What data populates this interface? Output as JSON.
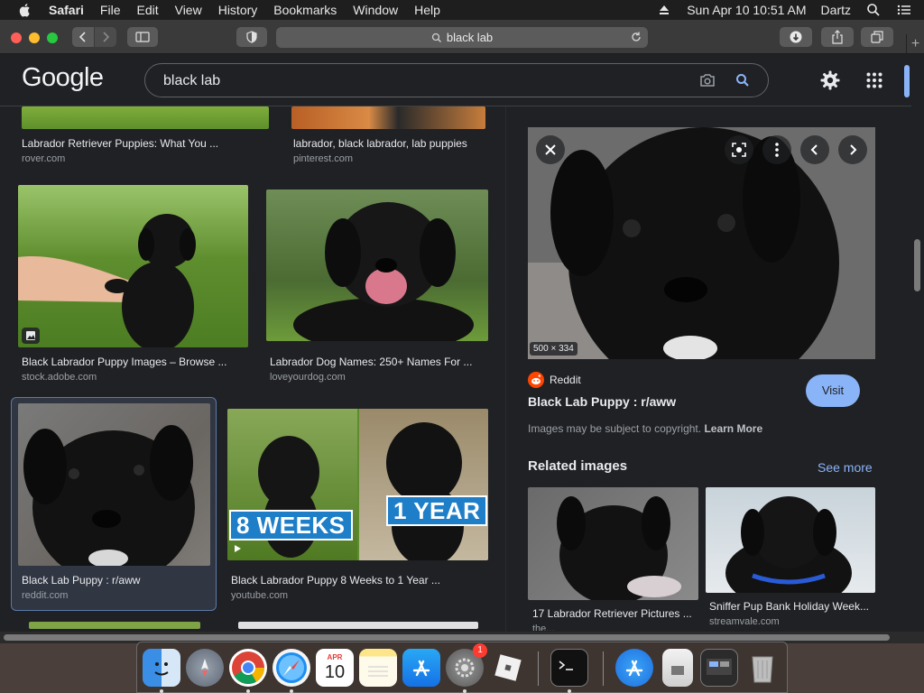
{
  "menubar": {
    "app_name": "Safari",
    "menus": [
      "File",
      "Edit",
      "View",
      "History",
      "Bookmarks",
      "Window",
      "Help"
    ],
    "datetime": "Sun Apr 10  10:51 AM",
    "user": "Dartz"
  },
  "browser": {
    "url_text": "black lab"
  },
  "google": {
    "logo": "Google",
    "query": "black lab"
  },
  "results": [
    {
      "caption": "Labrador Retriever Puppies: What You ...",
      "source": "rover.com"
    },
    {
      "caption": "labrador, black labrador, lab puppies",
      "source": "pinterest.com"
    },
    {
      "caption": "Black Labrador Puppy Images – Browse ...",
      "source": "stock.adobe.com"
    },
    {
      "caption": "Labrador Dog Names: 250+ Names For ...",
      "source": "loveyourdog.com"
    },
    {
      "caption": "Black Lab Puppy : r/aww",
      "source": "reddit.com"
    },
    {
      "caption": "Black Labrador Puppy 8 Weeks to 1 Year ...",
      "source": "youtube.com"
    }
  ],
  "video_overlay": {
    "left": "8 WEEKS",
    "right": "1 YEAR"
  },
  "preview": {
    "dimensions": "500 × 334",
    "site": "Reddit",
    "title": "Black Lab Puppy : r/aww",
    "visit_label": "Visit",
    "copyright_text": "Images may be subject to copyright.",
    "learn_more": "Learn More",
    "related_title": "Related images",
    "see_more": "See more",
    "related": [
      {
        "caption": "17 Labrador Retriever Pictures ...",
        "source": "the..."
      },
      {
        "caption": "Sniffer Pup Bank Holiday Week...",
        "source": "streamvale.com"
      }
    ]
  },
  "dock": {
    "calendar_month": "APR",
    "calendar_day": "10",
    "settings_badge": "1"
  },
  "colors": {
    "google_bg": "#202124",
    "accent_blue": "#8ab4f8",
    "reddit_orange": "#ff4500"
  }
}
